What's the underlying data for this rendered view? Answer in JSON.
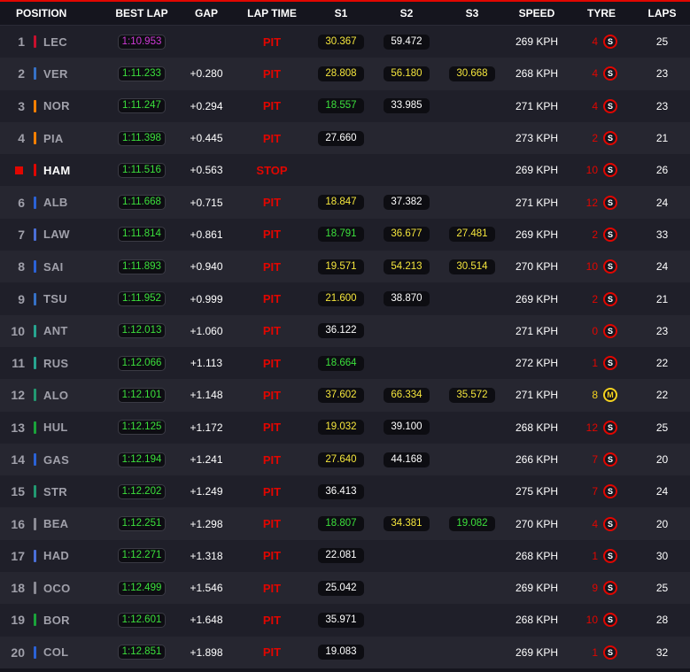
{
  "header": {
    "position": "POSITION",
    "best_lap": "BEST LAP",
    "gap": "GAP",
    "lap_time": "LAP TIME",
    "s1": "S1",
    "s2": "S2",
    "s3": "S3",
    "speed": "SPEED",
    "tyre": "TYRE",
    "laps": "LAPS"
  },
  "colors": {
    "accent_red": "#e10600",
    "purple": "#d03ad8",
    "green": "#3ce03c",
    "yellow": "#f5e63c",
    "white": "#ffffff",
    "soft_tyre": "#e10600",
    "medium_tyre": "#f5d21f"
  },
  "rows": [
    {
      "pos": "1",
      "driver": "LEC",
      "team_color": "#c8102e",
      "best": "1:10.953",
      "best_color": "#d03ad8",
      "gap": "",
      "status": "PIT",
      "s1": "30.367",
      "s1c": "#f5e63c",
      "s2": "59.472",
      "s2c": "#ffffff",
      "s3": "",
      "s3c": "#ffffff",
      "speed": "269 KPH",
      "tyre_age": "4",
      "tyre_age_color": "#e10600",
      "tyre": "S",
      "laps": "25"
    },
    {
      "pos": "2",
      "driver": "VER",
      "team_color": "#3671c6",
      "best": "1:11.233",
      "best_color": "#3ce03c",
      "gap": "+0.280",
      "status": "PIT",
      "s1": "28.808",
      "s1c": "#f5e63c",
      "s2": "56.180",
      "s2c": "#f5e63c",
      "s3": "30.668",
      "s3c": "#f5e63c",
      "speed": "268 KPH",
      "tyre_age": "4",
      "tyre_age_color": "#e10600",
      "tyre": "S",
      "laps": "23"
    },
    {
      "pos": "3",
      "driver": "NOR",
      "team_color": "#ff8000",
      "best": "1:11.247",
      "best_color": "#3ce03c",
      "gap": "+0.294",
      "status": "PIT",
      "s1": "18.557",
      "s1c": "#3ce03c",
      "s2": "33.985",
      "s2c": "#ffffff",
      "s3": "",
      "s3c": "#ffffff",
      "speed": "271 KPH",
      "tyre_age": "4",
      "tyre_age_color": "#e10600",
      "tyre": "S",
      "laps": "23"
    },
    {
      "pos": "4",
      "driver": "PIA",
      "team_color": "#ff8000",
      "best": "1:11.398",
      "best_color": "#3ce03c",
      "gap": "+0.445",
      "status": "PIT",
      "s1": "27.660",
      "s1c": "#ffffff",
      "s2": "",
      "s2c": "#ffffff",
      "s3": "",
      "s3c": "#ffffff",
      "speed": "273 KPH",
      "tyre_age": "2",
      "tyre_age_color": "#e10600",
      "tyre": "S",
      "laps": "21"
    },
    {
      "pos": "",
      "retired": true,
      "driver": "HAM",
      "team_color": "#e10600",
      "best": "1:11.516",
      "best_color": "#3ce03c",
      "gap": "+0.563",
      "status": "STOP",
      "s1": "",
      "s1c": "#ffffff",
      "s2": "",
      "s2c": "#ffffff",
      "s3": "",
      "s3c": "#ffffff",
      "speed": "269 KPH",
      "tyre_age": "10",
      "tyre_age_color": "#e10600",
      "tyre": "S",
      "laps": "26"
    },
    {
      "pos": "6",
      "driver": "ALB",
      "team_color": "#2b62d6",
      "best": "1:11.668",
      "best_color": "#3ce03c",
      "gap": "+0.715",
      "status": "PIT",
      "s1": "18.847",
      "s1c": "#f5e63c",
      "s2": "37.382",
      "s2c": "#ffffff",
      "s3": "",
      "s3c": "#ffffff",
      "speed": "271 KPH",
      "tyre_age": "12",
      "tyre_age_color": "#e10600",
      "tyre": "S",
      "laps": "24"
    },
    {
      "pos": "7",
      "driver": "LAW",
      "team_color": "#4a6fd8",
      "best": "1:11.814",
      "best_color": "#3ce03c",
      "gap": "+0.861",
      "status": "PIT",
      "s1": "18.791",
      "s1c": "#3ce03c",
      "s2": "36.677",
      "s2c": "#f5e63c",
      "s3": "27.481",
      "s3c": "#f5e63c",
      "speed": "269 KPH",
      "tyre_age": "2",
      "tyre_age_color": "#e10600",
      "tyre": "S",
      "laps": "33"
    },
    {
      "pos": "8",
      "driver": "SAI",
      "team_color": "#2b62d6",
      "best": "1:11.893",
      "best_color": "#3ce03c",
      "gap": "+0.940",
      "status": "PIT",
      "s1": "19.571",
      "s1c": "#f5e63c",
      "s2": "54.213",
      "s2c": "#f5e63c",
      "s3": "30.514",
      "s3c": "#f5e63c",
      "speed": "270 KPH",
      "tyre_age": "10",
      "tyre_age_color": "#e10600",
      "tyre": "S",
      "laps": "24"
    },
    {
      "pos": "9",
      "driver": "TSU",
      "team_color": "#3671c6",
      "best": "1:11.952",
      "best_color": "#3ce03c",
      "gap": "+0.999",
      "status": "PIT",
      "s1": "21.600",
      "s1c": "#f5e63c",
      "s2": "38.870",
      "s2c": "#ffffff",
      "s3": "",
      "s3c": "#ffffff",
      "speed": "269 KPH",
      "tyre_age": "2",
      "tyre_age_color": "#e10600",
      "tyre": "S",
      "laps": "21"
    },
    {
      "pos": "10",
      "driver": "ANT",
      "team_color": "#27a590",
      "best": "1:12.013",
      "best_color": "#3ce03c",
      "gap": "+1.060",
      "status": "PIT",
      "s1": "36.122",
      "s1c": "#ffffff",
      "s2": "",
      "s2c": "#ffffff",
      "s3": "",
      "s3c": "#ffffff",
      "speed": "271 KPH",
      "tyre_age": "0",
      "tyre_age_color": "#e10600",
      "tyre": "S",
      "laps": "23"
    },
    {
      "pos": "11",
      "driver": "RUS",
      "team_color": "#27a590",
      "best": "1:12.066",
      "best_color": "#3ce03c",
      "gap": "+1.113",
      "status": "PIT",
      "s1": "18.664",
      "s1c": "#3ce03c",
      "s2": "",
      "s2c": "#ffffff",
      "s3": "",
      "s3c": "#ffffff",
      "speed": "272 KPH",
      "tyre_age": "1",
      "tyre_age_color": "#e10600",
      "tyre": "S",
      "laps": "22"
    },
    {
      "pos": "12",
      "driver": "ALO",
      "team_color": "#229971",
      "best": "1:12.101",
      "best_color": "#3ce03c",
      "gap": "+1.148",
      "status": "PIT",
      "s1": "37.602",
      "s1c": "#f5e63c",
      "s2": "66.334",
      "s2c": "#f5e63c",
      "s3": "35.572",
      "s3c": "#f5e63c",
      "speed": "271 KPH",
      "tyre_age": "8",
      "tyre_age_color": "#f5d21f",
      "tyre": "M",
      "laps": "22"
    },
    {
      "pos": "13",
      "driver": "HUL",
      "team_color": "#1aa33a",
      "best": "1:12.125",
      "best_color": "#3ce03c",
      "gap": "+1.172",
      "status": "PIT",
      "s1": "19.032",
      "s1c": "#f5e63c",
      "s2": "39.100",
      "s2c": "#ffffff",
      "s3": "",
      "s3c": "#ffffff",
      "speed": "268 KPH",
      "tyre_age": "12",
      "tyre_age_color": "#e10600",
      "tyre": "S",
      "laps": "25"
    },
    {
      "pos": "14",
      "driver": "GAS",
      "team_color": "#2b62d6",
      "best": "1:12.194",
      "best_color": "#3ce03c",
      "gap": "+1.241",
      "status": "PIT",
      "s1": "27.640",
      "s1c": "#f5e63c",
      "s2": "44.168",
      "s2c": "#ffffff",
      "s3": "",
      "s3c": "#ffffff",
      "speed": "266 KPH",
      "tyre_age": "7",
      "tyre_age_color": "#e10600",
      "tyre": "S",
      "laps": "20"
    },
    {
      "pos": "15",
      "driver": "STR",
      "team_color": "#229971",
      "best": "1:12.202",
      "best_color": "#3ce03c",
      "gap": "+1.249",
      "status": "PIT",
      "s1": "36.413",
      "s1c": "#ffffff",
      "s2": "",
      "s2c": "#ffffff",
      "s3": "",
      "s3c": "#ffffff",
      "speed": "275 KPH",
      "tyre_age": "7",
      "tyre_age_color": "#e10600",
      "tyre": "S",
      "laps": "24"
    },
    {
      "pos": "16",
      "driver": "BEA",
      "team_color": "#8a8a94",
      "best": "1:12.251",
      "best_color": "#3ce03c",
      "gap": "+1.298",
      "status": "PIT",
      "s1": "18.807",
      "s1c": "#3ce03c",
      "s2": "34.381",
      "s2c": "#f5e63c",
      "s3": "19.082",
      "s3c": "#3ce03c",
      "speed": "270 KPH",
      "tyre_age": "4",
      "tyre_age_color": "#e10600",
      "tyre": "S",
      "laps": "20"
    },
    {
      "pos": "17",
      "driver": "HAD",
      "team_color": "#4a6fd8",
      "best": "1:12.271",
      "best_color": "#3ce03c",
      "gap": "+1.318",
      "status": "PIT",
      "s1": "22.081",
      "s1c": "#ffffff",
      "s2": "",
      "s2c": "#ffffff",
      "s3": "",
      "s3c": "#ffffff",
      "speed": "268 KPH",
      "tyre_age": "1",
      "tyre_age_color": "#e10600",
      "tyre": "S",
      "laps": "30"
    },
    {
      "pos": "18",
      "driver": "OCO",
      "team_color": "#8a8a94",
      "best": "1:12.499",
      "best_color": "#3ce03c",
      "gap": "+1.546",
      "status": "PIT",
      "s1": "25.042",
      "s1c": "#ffffff",
      "s2": "",
      "s2c": "#ffffff",
      "s3": "",
      "s3c": "#ffffff",
      "speed": "269 KPH",
      "tyre_age": "9",
      "tyre_age_color": "#e10600",
      "tyre": "S",
      "laps": "25"
    },
    {
      "pos": "19",
      "driver": "BOR",
      "team_color": "#1aa33a",
      "best": "1:12.601",
      "best_color": "#3ce03c",
      "gap": "+1.648",
      "status": "PIT",
      "s1": "35.971",
      "s1c": "#ffffff",
      "s2": "",
      "s2c": "#ffffff",
      "s3": "",
      "s3c": "#ffffff",
      "speed": "268 KPH",
      "tyre_age": "10",
      "tyre_age_color": "#e10600",
      "tyre": "S",
      "laps": "28"
    },
    {
      "pos": "20",
      "driver": "COL",
      "team_color": "#2b62d6",
      "best": "1:12.851",
      "best_color": "#3ce03c",
      "gap": "+1.898",
      "status": "PIT",
      "s1": "19.083",
      "s1c": "#ffffff",
      "s2": "",
      "s2c": "#ffffff",
      "s3": "",
      "s3c": "#ffffff",
      "speed": "269 KPH",
      "tyre_age": "1",
      "tyre_age_color": "#e10600",
      "tyre": "S",
      "laps": "32"
    }
  ]
}
